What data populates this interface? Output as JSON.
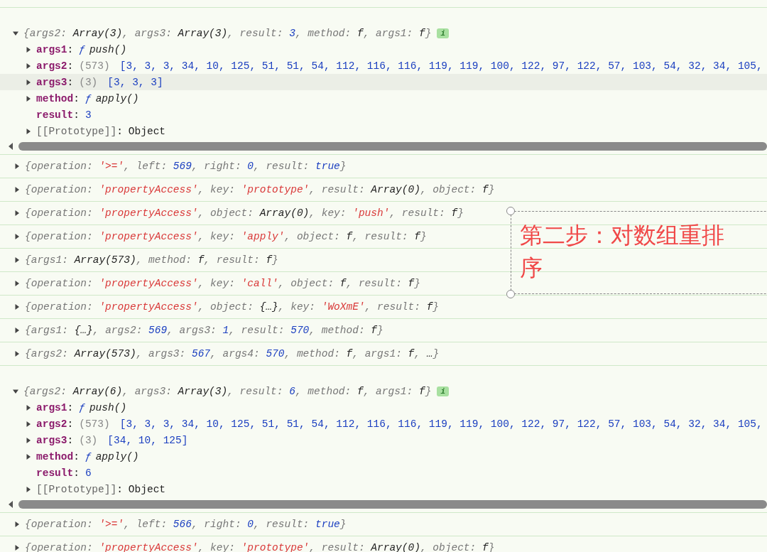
{
  "entries": [
    {
      "kind": "expanded",
      "badge": "i",
      "summary": [
        {
          "kind": "g",
          "text": "{args2: "
        },
        {
          "kind": "o",
          "text": "Array(3)"
        },
        {
          "kind": "g",
          "text": ", args3: "
        },
        {
          "kind": "o",
          "text": "Array(3)"
        },
        {
          "kind": "g",
          "text": ", result: "
        },
        {
          "kind": "n",
          "text": "3"
        },
        {
          "kind": "g",
          "text": ", method: "
        },
        {
          "kind": "o",
          "text": "f"
        },
        {
          "kind": "g",
          "text": ", args1: "
        },
        {
          "kind": "o",
          "text": "f"
        },
        {
          "kind": "g",
          "text": "}"
        }
      ],
      "props": [
        {
          "name": "args1",
          "expandable": true,
          "internal": false,
          "selected": false,
          "value": [
            {
              "kind": "p",
              "text": ":"
            },
            {
              "kind": "fk",
              "text": "ƒ"
            },
            {
              "kind": "fn",
              "text": "push()"
            }
          ]
        },
        {
          "name": "args2",
          "expandable": true,
          "internal": false,
          "selected": false,
          "value": [
            {
              "kind": "p",
              "text": ":"
            },
            {
              "kind": "c",
              "text": "(573)"
            },
            {
              "kind": "arr",
              "text": "[3, 3, 3, 34, 10, 125, 51, 51, 54, 112, 116, 116, 119, 119, 100, 122, 97, 122, 57, 103, 54, 32, 34, 105,"
            }
          ]
        },
        {
          "name": "args3",
          "expandable": true,
          "internal": false,
          "selected": true,
          "value": [
            {
              "kind": "p",
              "text": ":"
            },
            {
              "kind": "c",
              "text": "(3)"
            },
            {
              "kind": "arr",
              "text": "[3, 3, 3]"
            }
          ]
        },
        {
          "name": "method",
          "expandable": true,
          "internal": false,
          "selected": false,
          "value": [
            {
              "kind": "p",
              "text": ":"
            },
            {
              "kind": "fk",
              "text": "ƒ"
            },
            {
              "kind": "fn",
              "text": "apply()"
            }
          ]
        },
        {
          "name": "result",
          "expandable": false,
          "internal": false,
          "selected": false,
          "value": [
            {
              "kind": "p",
              "text": ":"
            },
            {
              "kind": "v",
              "text": "3"
            }
          ]
        },
        {
          "name": "[[Prototype]]",
          "expandable": true,
          "internal": true,
          "selected": false,
          "value": [
            {
              "kind": "p",
              "text": ":"
            },
            {
              "kind": "o",
              "text": "Object"
            }
          ]
        }
      ]
    },
    {
      "kind": "collapsed",
      "summary": [
        {
          "kind": "g",
          "text": "{operation: "
        },
        {
          "kind": "s",
          "text": "'>='"
        },
        {
          "kind": "g",
          "text": ", left: "
        },
        {
          "kind": "n",
          "text": "569"
        },
        {
          "kind": "g",
          "text": ", right: "
        },
        {
          "kind": "n",
          "text": "0"
        },
        {
          "kind": "g",
          "text": ", result: "
        },
        {
          "kind": "n",
          "text": "true"
        },
        {
          "kind": "g",
          "text": "}"
        }
      ]
    },
    {
      "kind": "collapsed",
      "summary": [
        {
          "kind": "g",
          "text": "{operation: "
        },
        {
          "kind": "s",
          "text": "'propertyAccess'"
        },
        {
          "kind": "g",
          "text": ", key: "
        },
        {
          "kind": "s",
          "text": "'prototype'"
        },
        {
          "kind": "g",
          "text": ", result: "
        },
        {
          "kind": "o",
          "text": "Array(0)"
        },
        {
          "kind": "g",
          "text": ", object: "
        },
        {
          "kind": "o",
          "text": "f"
        },
        {
          "kind": "g",
          "text": "}"
        }
      ]
    },
    {
      "kind": "collapsed",
      "summary": [
        {
          "kind": "g",
          "text": "{operation: "
        },
        {
          "kind": "s",
          "text": "'propertyAccess'"
        },
        {
          "kind": "g",
          "text": ", object: "
        },
        {
          "kind": "o",
          "text": "Array(0)"
        },
        {
          "kind": "g",
          "text": ", key: "
        },
        {
          "kind": "s",
          "text": "'push'"
        },
        {
          "kind": "g",
          "text": ", result: "
        },
        {
          "kind": "o",
          "text": "f"
        },
        {
          "kind": "g",
          "text": "}"
        }
      ]
    },
    {
      "kind": "collapsed",
      "summary": [
        {
          "kind": "g",
          "text": "{operation: "
        },
        {
          "kind": "s",
          "text": "'propertyAccess'"
        },
        {
          "kind": "g",
          "text": ", key: "
        },
        {
          "kind": "s",
          "text": "'apply'"
        },
        {
          "kind": "g",
          "text": ", object: "
        },
        {
          "kind": "o",
          "text": "f"
        },
        {
          "kind": "g",
          "text": ", result: "
        },
        {
          "kind": "o",
          "text": "f"
        },
        {
          "kind": "g",
          "text": "}"
        }
      ]
    },
    {
      "kind": "collapsed",
      "summary": [
        {
          "kind": "g",
          "text": "{args1: "
        },
        {
          "kind": "o",
          "text": "Array(573)"
        },
        {
          "kind": "g",
          "text": ", method: "
        },
        {
          "kind": "o",
          "text": "f"
        },
        {
          "kind": "g",
          "text": ", result: "
        },
        {
          "kind": "o",
          "text": "f"
        },
        {
          "kind": "g",
          "text": "}"
        }
      ]
    },
    {
      "kind": "collapsed",
      "summary": [
        {
          "kind": "g",
          "text": "{operation: "
        },
        {
          "kind": "s",
          "text": "'propertyAccess'"
        },
        {
          "kind": "g",
          "text": ", key: "
        },
        {
          "kind": "s",
          "text": "'call'"
        },
        {
          "kind": "g",
          "text": ", object: "
        },
        {
          "kind": "o",
          "text": "f"
        },
        {
          "kind": "g",
          "text": ", result: "
        },
        {
          "kind": "o",
          "text": "f"
        },
        {
          "kind": "g",
          "text": "}"
        }
      ]
    },
    {
      "kind": "collapsed",
      "summary": [
        {
          "kind": "g",
          "text": "{operation: "
        },
        {
          "kind": "s",
          "text": "'propertyAccess'"
        },
        {
          "kind": "g",
          "text": ", object: "
        },
        {
          "kind": "o",
          "text": "{…}"
        },
        {
          "kind": "g",
          "text": ", key: "
        },
        {
          "kind": "s",
          "text": "'WoXmE'"
        },
        {
          "kind": "g",
          "text": ", result: "
        },
        {
          "kind": "o",
          "text": "f"
        },
        {
          "kind": "g",
          "text": "}"
        }
      ]
    },
    {
      "kind": "collapsed",
      "summary": [
        {
          "kind": "g",
          "text": "{args1: "
        },
        {
          "kind": "o",
          "text": "{…}"
        },
        {
          "kind": "g",
          "text": ", args2: "
        },
        {
          "kind": "n",
          "text": "569"
        },
        {
          "kind": "g",
          "text": ", args3: "
        },
        {
          "kind": "n",
          "text": "1"
        },
        {
          "kind": "g",
          "text": ", result: "
        },
        {
          "kind": "n",
          "text": "570"
        },
        {
          "kind": "g",
          "text": ", method: "
        },
        {
          "kind": "o",
          "text": "f"
        },
        {
          "kind": "g",
          "text": "}"
        }
      ]
    },
    {
      "kind": "collapsed",
      "summary": [
        {
          "kind": "g",
          "text": "{args2: "
        },
        {
          "kind": "o",
          "text": "Array(573)"
        },
        {
          "kind": "g",
          "text": ", args3: "
        },
        {
          "kind": "n",
          "text": "567"
        },
        {
          "kind": "g",
          "text": ", args4: "
        },
        {
          "kind": "n",
          "text": "570"
        },
        {
          "kind": "g",
          "text": ", method: "
        },
        {
          "kind": "o",
          "text": "f"
        },
        {
          "kind": "g",
          "text": ", args1: "
        },
        {
          "kind": "o",
          "text": "f"
        },
        {
          "kind": "g",
          "text": ",  "
        },
        {
          "kind": "o",
          "text": "…"
        },
        {
          "kind": "g",
          "text": "}"
        }
      ]
    },
    {
      "kind": "expanded",
      "badge": "i",
      "summary": [
        {
          "kind": "g",
          "text": "{args2: "
        },
        {
          "kind": "o",
          "text": "Array(6)"
        },
        {
          "kind": "g",
          "text": ", args3: "
        },
        {
          "kind": "o",
          "text": "Array(3)"
        },
        {
          "kind": "g",
          "text": ", result: "
        },
        {
          "kind": "n",
          "text": "6"
        },
        {
          "kind": "g",
          "text": ", method: "
        },
        {
          "kind": "o",
          "text": "f"
        },
        {
          "kind": "g",
          "text": ", args1: "
        },
        {
          "kind": "o",
          "text": "f"
        },
        {
          "kind": "g",
          "text": "}"
        }
      ],
      "props": [
        {
          "name": "args1",
          "expandable": true,
          "internal": false,
          "selected": false,
          "value": [
            {
              "kind": "p",
              "text": ":"
            },
            {
              "kind": "fk",
              "text": "ƒ"
            },
            {
              "kind": "fn",
              "text": "push()"
            }
          ]
        },
        {
          "name": "args2",
          "expandable": true,
          "internal": false,
          "selected": false,
          "value": [
            {
              "kind": "p",
              "text": ":"
            },
            {
              "kind": "c",
              "text": "(573)"
            },
            {
              "kind": "arr",
              "text": "[3, 3, 3, 34, 10, 125, 51, 51, 54, 112, 116, 116, 119, 119, 100, 122, 97, 122, 57, 103, 54, 32, 34, 105,"
            }
          ]
        },
        {
          "name": "args3",
          "expandable": true,
          "internal": false,
          "selected": false,
          "value": [
            {
              "kind": "p",
              "text": ":"
            },
            {
              "kind": "c",
              "text": "(3)"
            },
            {
              "kind": "arr",
              "text": "[34, 10, 125]"
            }
          ]
        },
        {
          "name": "method",
          "expandable": true,
          "internal": false,
          "selected": false,
          "value": [
            {
              "kind": "p",
              "text": ":"
            },
            {
              "kind": "fk",
              "text": "ƒ"
            },
            {
              "kind": "fn",
              "text": "apply()"
            }
          ]
        },
        {
          "name": "result",
          "expandable": false,
          "internal": false,
          "selected": false,
          "value": [
            {
              "kind": "p",
              "text": ":"
            },
            {
              "kind": "v",
              "text": "6"
            }
          ]
        },
        {
          "name": "[[Prototype]]",
          "expandable": true,
          "internal": true,
          "selected": false,
          "value": [
            {
              "kind": "p",
              "text": ":"
            },
            {
              "kind": "o",
              "text": "Object"
            }
          ]
        }
      ]
    },
    {
      "kind": "collapsed",
      "summary": [
        {
          "kind": "g",
          "text": "{operation: "
        },
        {
          "kind": "s",
          "text": "'>='"
        },
        {
          "kind": "g",
          "text": ", left: "
        },
        {
          "kind": "n",
          "text": "566"
        },
        {
          "kind": "g",
          "text": ", right: "
        },
        {
          "kind": "n",
          "text": "0"
        },
        {
          "kind": "g",
          "text": ", result: "
        },
        {
          "kind": "n",
          "text": "true"
        },
        {
          "kind": "g",
          "text": "}"
        }
      ]
    },
    {
      "kind": "collapsed",
      "summary": [
        {
          "kind": "g",
          "text": "{operation: "
        },
        {
          "kind": "s",
          "text": "'propertyAccess'"
        },
        {
          "kind": "g",
          "text": ", key: "
        },
        {
          "kind": "s",
          "text": "'prototype'"
        },
        {
          "kind": "g",
          "text": ", result: "
        },
        {
          "kind": "o",
          "text": "Array(0)"
        },
        {
          "kind": "g",
          "text": ", object: "
        },
        {
          "kind": "o",
          "text": "f"
        },
        {
          "kind": "g",
          "text": "}"
        }
      ]
    }
  ],
  "annotation": {
    "text": "第二步：对数组重排序"
  }
}
